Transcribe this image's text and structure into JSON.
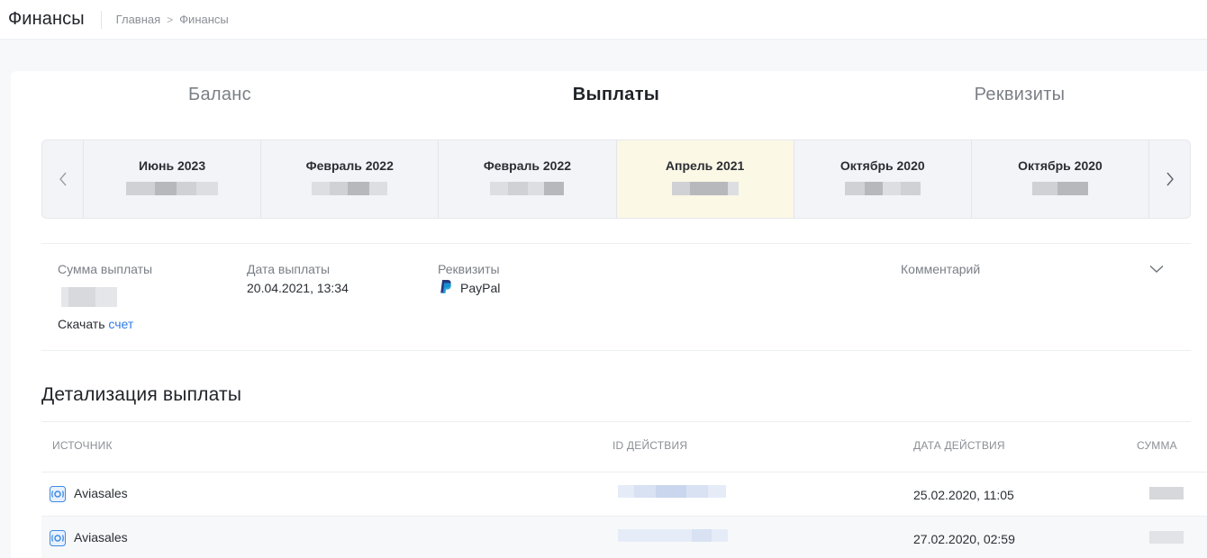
{
  "header": {
    "title": "Финансы",
    "breadcrumb": [
      "Главная",
      "Финансы"
    ],
    "breadcrumb_separator": ">"
  },
  "tabs": [
    {
      "label": "Баланс",
      "active": false
    },
    {
      "label": "Выплаты",
      "active": true
    },
    {
      "label": "Реквизиты",
      "active": false
    }
  ],
  "carousel": {
    "prev_icon": "chevron-left-icon",
    "next_icon": "chevron-right-icon",
    "months": [
      {
        "label": "Июнь 2023",
        "active": false
      },
      {
        "label": "Февраль 2022",
        "active": false
      },
      {
        "label": "Февраль 2022",
        "active": false
      },
      {
        "label": "Апрель 2021",
        "active": true
      },
      {
        "label": "Октябрь 2020",
        "active": false
      },
      {
        "label": "Октябрь 2020",
        "active": false
      }
    ]
  },
  "payout": {
    "amount_label": "Сумма выплаты",
    "date_label": "Дата выплаты",
    "date_value": "20.04.2021, 13:34",
    "requisites_label": "Реквизиты",
    "requisites_value": "PayPal",
    "comment_label": "Комментарий",
    "download_text": "Скачать",
    "download_link": "счет"
  },
  "details": {
    "title": "Детализация выплаты",
    "columns": [
      "ИСТОЧНИК",
      "ID ДЕЙСТВИЯ",
      "ДАТА ДЕЙСТВИЯ",
      "СУММА"
    ],
    "rows": [
      {
        "source": "Aviasales",
        "date": "25.02.2020, 11:05"
      },
      {
        "source": "Aviasales",
        "date": "27.02.2020, 02:59"
      }
    ]
  },
  "colors": {
    "accent_link": "#2f7be5",
    "active_month_bg": "#fcf8e6",
    "paypal_dark": "#253b80",
    "paypal_light": "#179bd7"
  }
}
